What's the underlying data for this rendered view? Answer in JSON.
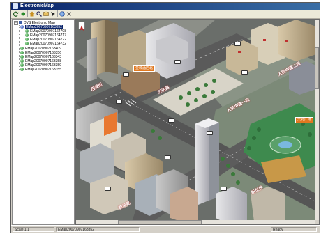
{
  "window": {
    "title": "ElectronicMap"
  },
  "toolbar": {
    "buttons": [
      {
        "icon": "refresh-icon"
      },
      {
        "icon": "back-icon"
      },
      {
        "icon": "home-icon"
      },
      {
        "icon": "search-icon"
      },
      {
        "icon": "layers-icon"
      },
      {
        "icon": "pointer-icon"
      },
      {
        "icon": "globe-icon"
      },
      {
        "icon": "close-icon"
      }
    ]
  },
  "tree": {
    "root_label": "DVS Electronic Map",
    "items": [
      {
        "label": "EMap20070907163352",
        "selected": true,
        "level": 1
      },
      {
        "label": "EMap20070907164708",
        "selected": false,
        "level": 2
      },
      {
        "label": "EMap20070907164717",
        "selected": false,
        "level": 2
      },
      {
        "label": "EMap20070907164722",
        "selected": false,
        "level": 2
      },
      {
        "label": "EMap20070907164732",
        "selected": false,
        "level": 2
      },
      {
        "label": "EMap20070907163409",
        "selected": false,
        "level": 1
      },
      {
        "label": "EMap20070907163356",
        "selected": false,
        "level": 1
      },
      {
        "label": "EMap20070907163343",
        "selected": false,
        "level": 1
      },
      {
        "label": "EMap20070907163358",
        "selected": false,
        "level": 1
      },
      {
        "label": "EMap20070907163359",
        "selected": false,
        "level": 1
      },
      {
        "label": "EMap20070907163355",
        "selected": false,
        "level": 1
      }
    ]
  },
  "map": {
    "labels": [
      {
        "text": "西湖街"
      },
      {
        "text": "万达路"
      },
      {
        "text": "人民中路一段"
      },
      {
        "text": "人民中路二段"
      },
      {
        "text": "新世界"
      },
      {
        "text": "新华路"
      }
    ],
    "tags": [
      {
        "text": "金城酒店北"
      },
      {
        "text": "天府广场"
      }
    ]
  },
  "status": {
    "left": "Scale 1:1",
    "middle": "EMap20070907163352",
    "right": "Ready"
  }
}
